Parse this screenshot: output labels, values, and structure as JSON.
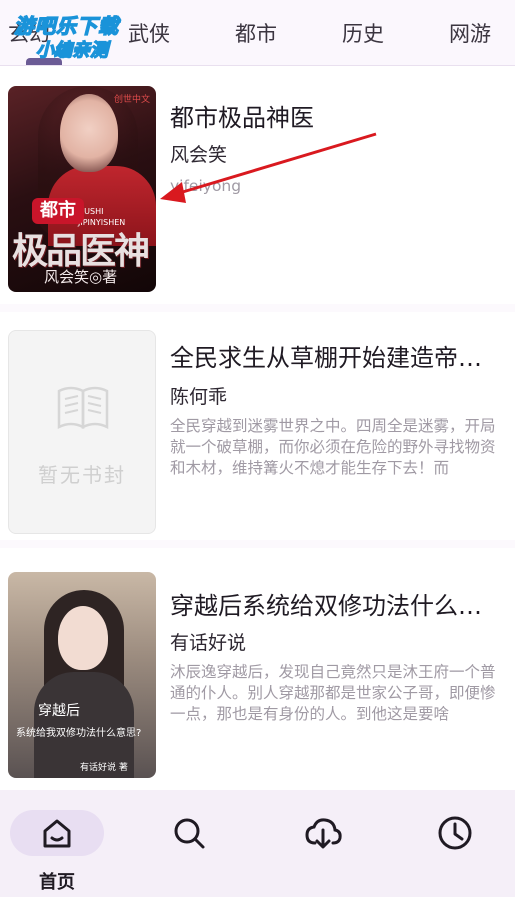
{
  "tabs": {
    "items": [
      "玄幻",
      "武侠",
      "都市",
      "历史",
      "网游"
    ],
    "active_index": 0
  },
  "watermark": {
    "line1": "游吧乐下载",
    "line2": "小编亲测"
  },
  "books": [
    {
      "title": "都市极品神医",
      "author": "风会笑",
      "intro": "yifeiyong",
      "cover": {
        "brand": "创世中文",
        "pinyin": "DUSHI JIPINYISHEN",
        "tag": "都市",
        "big": "极品医神",
        "author": "风会笑◎著"
      }
    },
    {
      "title": "全民求生从草棚开始建造帝…",
      "author": "陈何乖",
      "intro": "全民穿越到迷雾世界之中。四周全是迷雾，开局就一个破草棚，而你必须在危险的野外寻找物资和木材，维持篝火不熄才能生存下去！而",
      "cover": {
        "placeholder": "暂无书封"
      }
    },
    {
      "title": "穿越后系统给双修功法什么…",
      "author": "有话好说",
      "intro": "沐辰逸穿越后，发现自己竟然只是沐王府一个普通的仆人。别人穿越那都是世家公子哥，即便惨一点，那也是有身份的人。到他这是要啥",
      "cover": {
        "t1": "穿越后",
        "t2": "系统给我双修功法什么意思?",
        "t3": "有话好说 著"
      }
    }
  ],
  "bottom_nav": {
    "home": "首页",
    "active": "home",
    "icons": [
      "home-icon",
      "search-icon",
      "download-cloud-icon",
      "history-clock-icon"
    ]
  },
  "colors": {
    "accent": "#6b5b95",
    "nav_bg": "#f5eff8",
    "pill": "#e8def2",
    "arrow": "#d9191f"
  }
}
